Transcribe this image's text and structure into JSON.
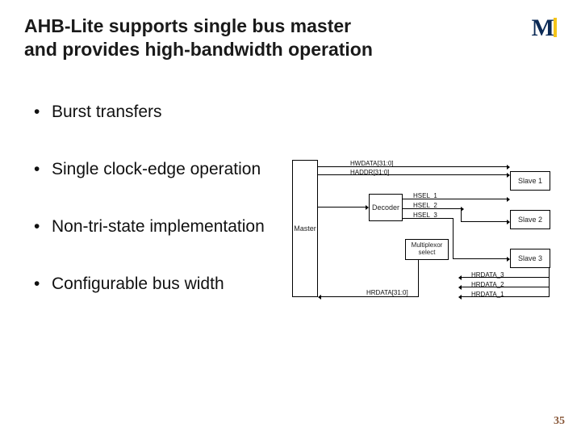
{
  "title": "AHB-Lite supports single bus master and provides high-bandwidth operation",
  "logo_letter": "M",
  "bullets": [
    "Burst transfers",
    "Single clock-edge operation",
    "Non-tri-state implementation",
    "Configurable bus width"
  ],
  "diagram": {
    "boxes": {
      "master": "Master",
      "decoder": "Decoder",
      "mux": "Multiplexor select",
      "slave1": "Slave 1",
      "slave2": "Slave 2",
      "slave3": "Slave 3"
    },
    "signals": {
      "hwdata": "HWDATA[31:0]",
      "haddr": "HADDR[31:0]",
      "hsel1": "HSEL_1",
      "hsel2": "HSEL_2",
      "hsel3": "HSEL_3",
      "hrdata_bus": "HRDATA[31:0]",
      "hrdata3": "HRDATA_3",
      "hrdata2": "HRDATA_2",
      "hrdata1": "HRDATA_1"
    }
  },
  "page_number": "35"
}
